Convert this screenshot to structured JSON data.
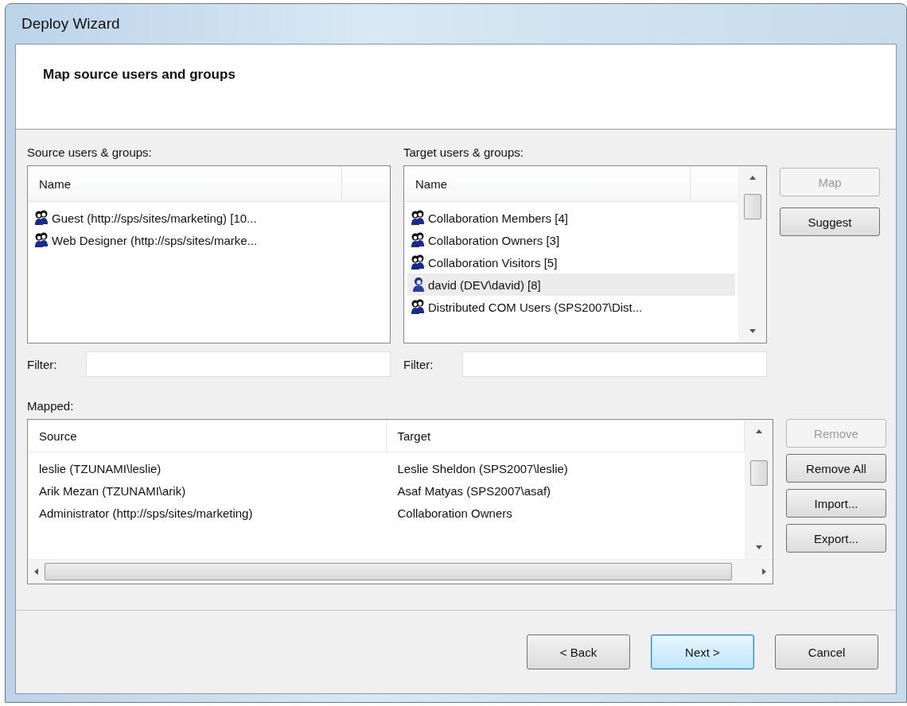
{
  "window": {
    "title": "Deploy Wizard"
  },
  "header": {
    "title": "Map source users and groups"
  },
  "source": {
    "label": "Source users & groups:",
    "column": "Name",
    "items": [
      {
        "kind": "group",
        "text": "Guest (http://sps/sites/marketing) [10...",
        "selected": false
      },
      {
        "kind": "group",
        "text": "Web Designer (http://sps/sites/marke...",
        "selected": false
      }
    ],
    "filter": {
      "label": "Filter:"
    }
  },
  "target": {
    "label": "Target users & groups:",
    "column": "Name",
    "items": [
      {
        "kind": "group",
        "text": "Collaboration Members [4]",
        "selected": false
      },
      {
        "kind": "group",
        "text": "Collaboration Owners [3]",
        "selected": false
      },
      {
        "kind": "group",
        "text": "Collaboration Visitors [5]",
        "selected": false
      },
      {
        "kind": "user",
        "text": "david (DEV\\david) [8]",
        "selected": true
      },
      {
        "kind": "group",
        "text": "Distributed COM Users (SPS2007\\Dist...",
        "selected": false
      }
    ],
    "filter": {
      "label": "Filter:"
    }
  },
  "side_buttons": [
    {
      "label": "Map",
      "disabled": true
    },
    {
      "label": "Suggest",
      "disabled": false
    }
  ],
  "mapped": {
    "label": "Mapped:",
    "columns": [
      "Source",
      "Target"
    ],
    "rows": [
      [
        "leslie (TZUNAMI\\leslie)",
        "Leslie Sheldon (SPS2007\\leslie)"
      ],
      [
        "Arik Mezan (TZUNAMI\\arik)",
        "Asaf Matyas (SPS2007\\asaf)"
      ],
      [
        "Administrator (http://sps/sites/marketing)",
        "Collaboration Owners"
      ]
    ]
  },
  "mapped_buttons": [
    {
      "label": "Remove",
      "disabled": true
    },
    {
      "label": "Remove All",
      "disabled": false
    },
    {
      "label": "Import...",
      "disabled": false
    },
    {
      "label": "Export...",
      "disabled": false
    }
  ],
  "footer_buttons": [
    {
      "label": "< Back",
      "focused": false
    },
    {
      "label": "Next >",
      "focused": true
    },
    {
      "label": "Cancel",
      "focused": false
    }
  ]
}
